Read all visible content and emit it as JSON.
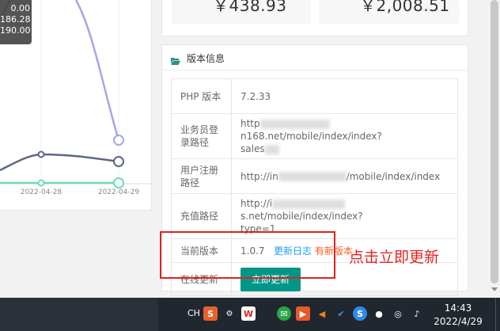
{
  "chart": {
    "tooltip_values": [
      "0.00",
      "186.28",
      "190.00"
    ],
    "x_labels": [
      "2022-04-28",
      "2022-04-29"
    ],
    "colors": {
      "purple": "#a6a6e8",
      "slate": "#5c6784",
      "green": "#6fdcb3",
      "grid": "#ececec"
    }
  },
  "chart_data": {
    "type": "line",
    "categories": [
      "2022-04-28",
      "2022-04-29"
    ],
    "series": [
      {
        "values": [
          null,
          190
        ]
      },
      {
        "values": [
          186.28,
          166
        ]
      },
      {
        "values": [
          0,
          0
        ]
      }
    ]
  },
  "stats": [
    {
      "value": "￥438.93"
    },
    {
      "value": "￥2,008.51"
    }
  ],
  "version_card": {
    "title": "版本信息",
    "rows": [
      {
        "key": "PHP 版本",
        "value": "7.2.33"
      },
      {
        "key": "业务员登录路径",
        "value_prefix": "http",
        "value_suffix": "n168.net/mobile/index/index?",
        "value_line2": "sales"
      },
      {
        "key": "用户注册路径",
        "value_prefix": "http://in",
        "value_suffix": "/mobile/index/index"
      },
      {
        "key": "充值路径",
        "value_prefix": "http://i",
        "value_suffix": "s.net/mobile/index/index?",
        "value_line2": "type=1"
      },
      {
        "key": "当前版本",
        "version": "1.0.7",
        "changelog": "更新日志",
        "new_version": "有新版本"
      },
      {
        "key": "在线更新",
        "button": "立即更新"
      }
    ]
  },
  "annotation": "点击立即更新",
  "taskbar": {
    "lang": "CH",
    "time": "14:43",
    "date": "2022/4/29"
  }
}
